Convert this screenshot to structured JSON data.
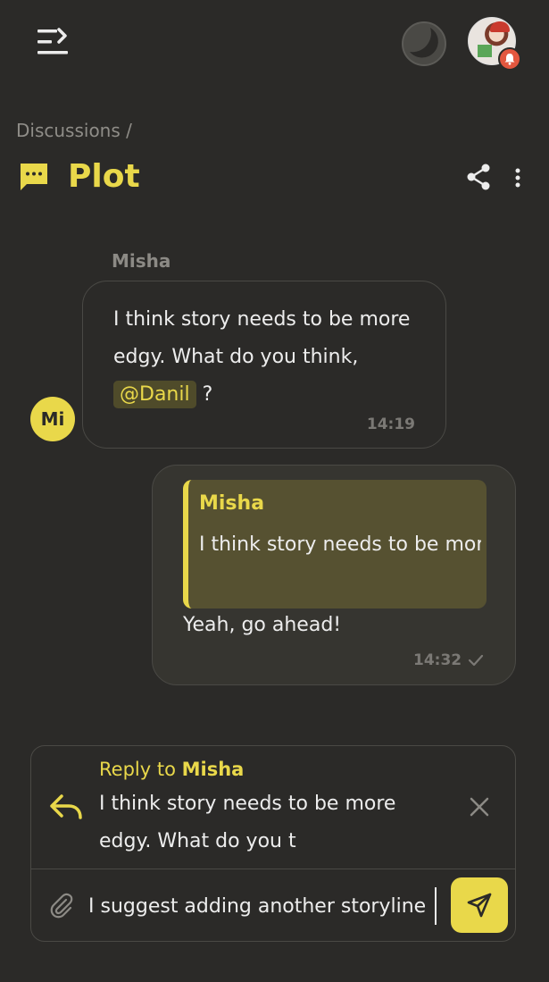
{
  "header": {
    "menu_icon": "menu-collapse-icon",
    "theme_icon": "moon-icon",
    "avatar_icon": "user-avatar",
    "notification_icon": "bell-icon"
  },
  "breadcrumb": {
    "text": "Discussions /"
  },
  "discussion": {
    "title": "Plot",
    "icon": "chat-bubble-icon"
  },
  "messages": [
    {
      "sender": "Misha",
      "avatar_initials": "Mi",
      "text_before": "I think story needs to be more edgy. What do you think,",
      "mention": "@Danil",
      "text_after": " ?",
      "time": "14:19"
    },
    {
      "quote_author": "Misha",
      "quote_text": "I think story needs to be more edgy. What do you t",
      "text": "Yeah, go ahead!",
      "time": "14:32",
      "status_icon": "check-icon"
    }
  ],
  "composer": {
    "reply_prefix": "Reply to",
    "reply_author": "Misha",
    "reply_text": "I think story needs to be more edgy. What do you t",
    "input_value": "I suggest adding another storyline",
    "send_icon": "send-icon",
    "attach_icon": "paperclip-icon"
  },
  "colors": {
    "background": "#2b2a28",
    "accent": "#e9d84a",
    "badge": "#e3573f"
  }
}
